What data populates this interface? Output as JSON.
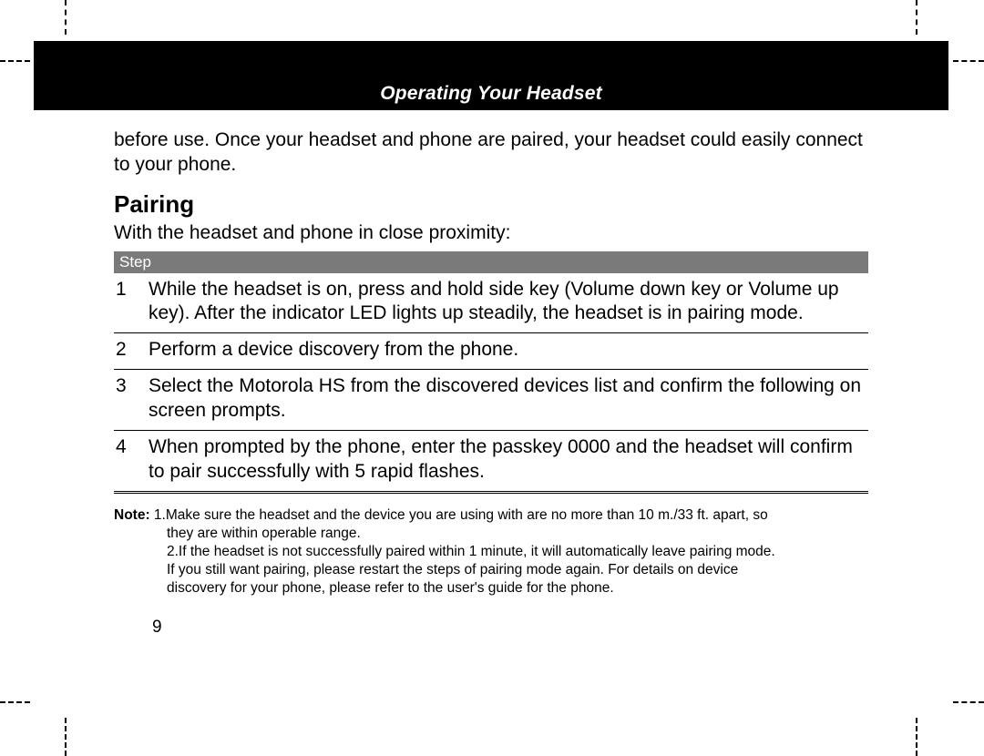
{
  "banner": {
    "title": "Operating Your Headset"
  },
  "lead": "before use.  Once your headset and phone are paired, your headset could easily connect to your phone.",
  "section_heading": "Pairing",
  "intro": "With the headset and phone in close proximity:",
  "step_header": "Step",
  "steps": [
    {
      "n": "1",
      "text": "While the headset is on, press and hold side key (Volume down key or Volume up key). After the indicator LED lights up steadily, the headset is in pairing mode."
    },
    {
      "n": "2",
      "text": "Perform a device discovery from the phone."
    },
    {
      "n": "3",
      "text": "Select the Motorola HS from the discovered devices list and confirm the following on screen prompts."
    },
    {
      "n": "4",
      "text": "When prompted by the phone, enter the passkey 0000 and the headset will confirm to pair successfully with 5 rapid flashes."
    }
  ],
  "note": {
    "label": "Note:",
    "item1_line1": "1.Make sure the headset and the device you are using with are no more than 10 m./33 ft. apart, so",
    "item1_line2": "they are within operable range.",
    "item2_line1": "2.If the headset is not successfully paired within 1 minute, it will automatically leave pairing mode.",
    "item2_line2": "If you still want pairing, please restart the steps of pairing mode again. For details on device",
    "item2_line3": "discovery for your phone, please refer to the user's guide for the phone."
  },
  "page_number": "9"
}
